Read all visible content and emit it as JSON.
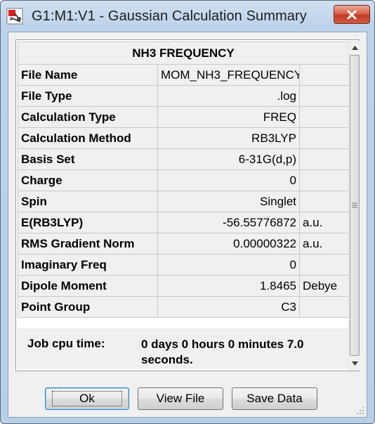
{
  "window": {
    "title": "G1:M1:V1 - Gaussian Calculation Summary",
    "close_symbol": "✕"
  },
  "summary": {
    "header": "NH3 FREQUENCY",
    "rows": [
      {
        "label": "File Name",
        "value": "MOM_NH3_FREQUENCY",
        "unit": ""
      },
      {
        "label": "File Type",
        "value": ".log",
        "unit": ""
      },
      {
        "label": "Calculation Type",
        "value": "FREQ",
        "unit": ""
      },
      {
        "label": "Calculation Method",
        "value": "RB3LYP",
        "unit": ""
      },
      {
        "label": "Basis Set",
        "value": "6-31G(d,p)",
        "unit": ""
      },
      {
        "label": "Charge",
        "value": "0",
        "unit": ""
      },
      {
        "label": "Spin",
        "value": "Singlet",
        "unit": ""
      },
      {
        "label": "E(RB3LYP)",
        "value": "-56.55776872",
        "unit": "a.u."
      },
      {
        "label": "RMS Gradient Norm",
        "value": "0.00000322",
        "unit": "a.u."
      },
      {
        "label": "Imaginary Freq",
        "value": "0",
        "unit": ""
      },
      {
        "label": "Dipole Moment",
        "value": "1.8465",
        "unit": "Debye"
      },
      {
        "label": "Point Group",
        "value": "C3",
        "unit": ""
      }
    ],
    "cpu_label": "Job cpu time:",
    "cpu_value": "0 days  0 hours  0 minutes  7.0 seconds."
  },
  "buttons": {
    "ok": "Ok",
    "view_file": "View File",
    "save_data": "Save Data"
  },
  "icons": {
    "app": "gaussian-app-icon",
    "close": "close-icon",
    "scroll_up": "scroll-up-arrow-icon",
    "scroll_down": "scroll-down-arrow-icon",
    "grip": "resize-grip-icon"
  },
  "colors": {
    "title_bar": "#bcd2ea",
    "close_button": "#c8432b",
    "panel": "#f0f0f0"
  }
}
